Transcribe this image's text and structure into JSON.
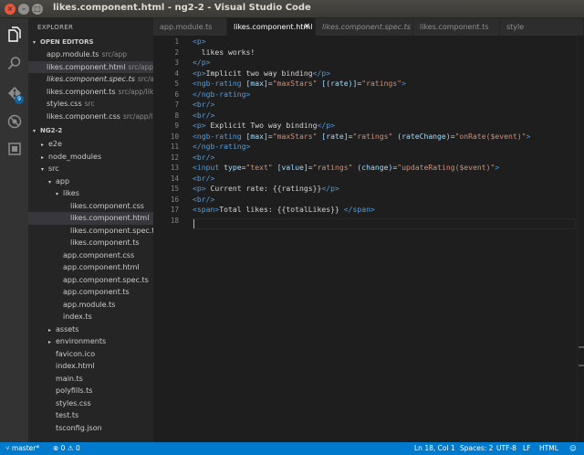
{
  "window": {
    "title": "likes.component.html - ng2-2 - Visual Studio Code"
  },
  "activity_bar": {
    "items": [
      {
        "name": "explorer",
        "icon": "files-icon"
      },
      {
        "name": "search",
        "icon": "search-icon"
      },
      {
        "name": "git",
        "icon": "git-icon",
        "badge": "9"
      },
      {
        "name": "debug",
        "icon": "debug-icon"
      },
      {
        "name": "extensions",
        "icon": "extensions-icon"
      }
    ]
  },
  "sidebar": {
    "title": "EXPLORER",
    "open_editors_header": "OPEN EDITORS",
    "open_editors": [
      {
        "name": "app.module.ts",
        "path": "src/app",
        "italic": false
      },
      {
        "name": "likes.component.html",
        "path": "src/app/...",
        "italic": false,
        "selected": true
      },
      {
        "name": "likes.component.spec.ts",
        "path": "src/ap...",
        "italic": true
      },
      {
        "name": "likes.component.ts",
        "path": "src/app/likes",
        "italic": false
      },
      {
        "name": "styles.css",
        "path": "src",
        "italic": false
      },
      {
        "name": "likes.component.css",
        "path": "src/app/l...",
        "italic": false
      }
    ],
    "project_header": "NG2-2",
    "tree": [
      {
        "label": "e2e",
        "depth": 0,
        "arrow": "▸"
      },
      {
        "label": "node_modules",
        "depth": 0,
        "arrow": "▸"
      },
      {
        "label": "src",
        "depth": 0,
        "arrow": "▾"
      },
      {
        "label": "app",
        "depth": 1,
        "arrow": "▾"
      },
      {
        "label": "likes",
        "depth": 2,
        "arrow": "▾"
      },
      {
        "label": "likes.component.css",
        "depth": 3,
        "arrow": ""
      },
      {
        "label": "likes.component.html",
        "depth": 3,
        "arrow": "",
        "selected": true
      },
      {
        "label": "likes.component.spec.ts",
        "depth": 3,
        "arrow": ""
      },
      {
        "label": "likes.component.ts",
        "depth": 3,
        "arrow": ""
      },
      {
        "label": "app.component.css",
        "depth": 2,
        "arrow": ""
      },
      {
        "label": "app.component.html",
        "depth": 2,
        "arrow": ""
      },
      {
        "label": "app.component.spec.ts",
        "depth": 2,
        "arrow": ""
      },
      {
        "label": "app.component.ts",
        "depth": 2,
        "arrow": ""
      },
      {
        "label": "app.module.ts",
        "depth": 2,
        "arrow": ""
      },
      {
        "label": "index.ts",
        "depth": 2,
        "arrow": ""
      },
      {
        "label": "assets",
        "depth": 1,
        "arrow": "▸"
      },
      {
        "label": "environments",
        "depth": 1,
        "arrow": "▸"
      },
      {
        "label": "favicon.ico",
        "depth": 1,
        "arrow": ""
      },
      {
        "label": "index.html",
        "depth": 1,
        "arrow": ""
      },
      {
        "label": "main.ts",
        "depth": 1,
        "arrow": ""
      },
      {
        "label": "polyfills.ts",
        "depth": 1,
        "arrow": ""
      },
      {
        "label": "styles.css",
        "depth": 1,
        "arrow": ""
      },
      {
        "label": "test.ts",
        "depth": 1,
        "arrow": ""
      },
      {
        "label": "tsconfig.json",
        "depth": 1,
        "arrow": ""
      }
    ]
  },
  "tabs": [
    {
      "label": "app.module.ts",
      "active": false,
      "italic": false
    },
    {
      "label": "likes.component.html",
      "active": true,
      "italic": false,
      "close": "×"
    },
    {
      "label": "likes.component.spec.ts",
      "active": false,
      "italic": true
    },
    {
      "label": "likes.component.ts",
      "active": false,
      "italic": false
    },
    {
      "label": "style",
      "active": false,
      "italic": false
    }
  ],
  "editor": {
    "lines": [
      [
        [
          "tag",
          "<p>"
        ]
      ],
      [
        [
          "txt",
          "  likes works!"
        ]
      ],
      [
        [
          "tag",
          "</p>"
        ]
      ],
      [
        [
          "tag",
          "<p>"
        ],
        [
          "txt",
          "Implicit two way binding"
        ],
        [
          "tag",
          "</p>"
        ]
      ],
      [
        [
          "tag",
          "<ngb-rating "
        ],
        [
          "attr",
          "[max]"
        ],
        [
          "txt",
          "="
        ],
        [
          "str",
          "\"maxStars\""
        ],
        [
          "txt",
          " "
        ],
        [
          "attr",
          "[(rate)]"
        ],
        [
          "txt",
          "="
        ],
        [
          "str",
          "\"ratings\""
        ],
        [
          "tag",
          ">"
        ]
      ],
      [
        [
          "tag",
          "</ngb-rating>"
        ]
      ],
      [
        [
          "tag",
          "<br/>"
        ]
      ],
      [
        [
          "tag",
          "<br/>"
        ]
      ],
      [
        [
          "tag",
          "<p>"
        ],
        [
          "txt",
          " Explicit Two way binding"
        ],
        [
          "tag",
          "</p>"
        ]
      ],
      [
        [
          "tag",
          "<ngb-rating "
        ],
        [
          "attr",
          "[max]"
        ],
        [
          "txt",
          "="
        ],
        [
          "str",
          "\"maxStars\""
        ],
        [
          "txt",
          " "
        ],
        [
          "attr",
          "[rate]"
        ],
        [
          "txt",
          "="
        ],
        [
          "str",
          "\"ratings\""
        ],
        [
          "txt",
          " "
        ],
        [
          "attr",
          "(rateChange)"
        ],
        [
          "txt",
          "="
        ],
        [
          "str",
          "\"onRate($event)\""
        ],
        [
          "tag",
          ">"
        ]
      ],
      [
        [
          "tag",
          "</ngb-rating>"
        ]
      ],
      [
        [
          "tag",
          "<br/>"
        ]
      ],
      [
        [
          "tag",
          "<input "
        ],
        [
          "attr",
          "type"
        ],
        [
          "txt",
          "="
        ],
        [
          "str",
          "\"text\""
        ],
        [
          "txt",
          " "
        ],
        [
          "attr",
          "[value]"
        ],
        [
          "txt",
          "="
        ],
        [
          "str",
          "\"ratings\""
        ],
        [
          "txt",
          " "
        ],
        [
          "attr",
          "(change)"
        ],
        [
          "txt",
          "="
        ],
        [
          "str",
          "\"updateRating($event)\""
        ],
        [
          "tag",
          ">"
        ]
      ],
      [
        [
          "tag",
          "<br/>"
        ]
      ],
      [
        [
          "tag",
          "<p>"
        ],
        [
          "txt",
          " Current rate: {{ratings}}"
        ],
        [
          "tag",
          "</p>"
        ]
      ],
      [
        [
          "tag",
          "<br/>"
        ]
      ],
      [
        [
          "tag",
          "<span>"
        ],
        [
          "txt",
          "Total likes: {{totalLikes}} "
        ],
        [
          "tag",
          "</span>"
        ]
      ],
      []
    ]
  },
  "statusbar": {
    "branch": "master*",
    "errors": "0",
    "warnings": "0",
    "position": "Ln 18, Col 1",
    "spaces": "Spaces: 2",
    "encoding": "UTF-8",
    "eol": "LF",
    "language": "HTML"
  }
}
